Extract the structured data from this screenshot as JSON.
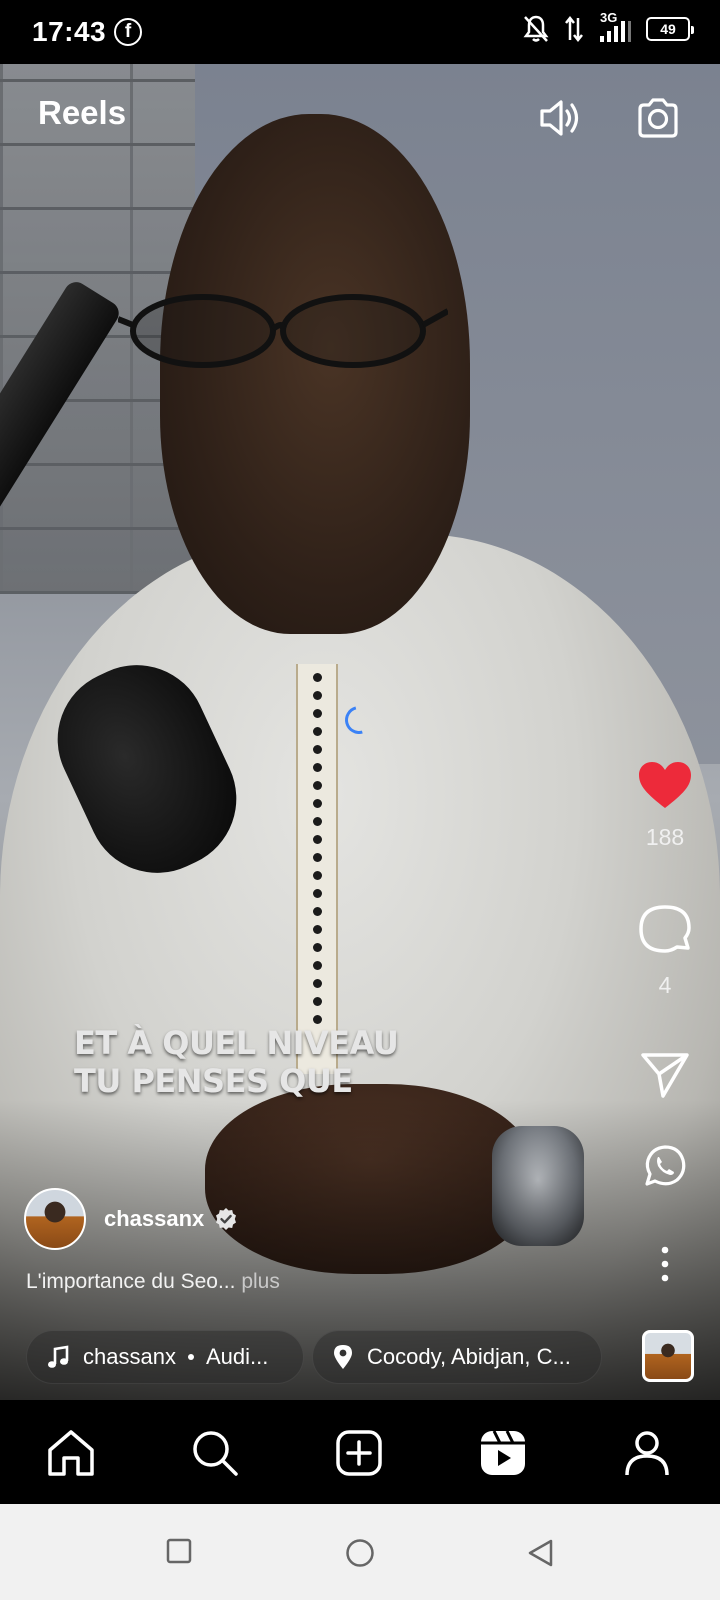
{
  "status_bar": {
    "time": "17:43",
    "network": "3G",
    "battery": "49",
    "icons": [
      "facebook-icon",
      "notifications-off-icon",
      "data-arrows-icon",
      "signal-icon",
      "battery-icon"
    ]
  },
  "header": {
    "title": "Reels",
    "icons": [
      "volume-icon",
      "camera-icon"
    ]
  },
  "video": {
    "caption_lines": [
      "ET À QUEL NIVEAU",
      "TU PENSES QUE"
    ],
    "loading": true
  },
  "actions": {
    "like_count": "188",
    "comment_count": "4",
    "colors": {
      "like": "#ed2a3a"
    },
    "icons": [
      "heart-icon",
      "comment-icon",
      "share-icon",
      "whatsapp-icon",
      "more-icon"
    ]
  },
  "post": {
    "author": "chassanx",
    "verified": true,
    "description": "L'importance du Seo...",
    "more_label": "plus",
    "audio_author": "chassanx",
    "audio_label": "Audi...",
    "location": "Cocody, Abidjan, C..."
  },
  "bottom_nav": [
    "home-icon",
    "search-icon",
    "create-icon",
    "reels-icon",
    "profile-icon"
  ],
  "system_nav": [
    "recents-button",
    "home-button",
    "back-button"
  ]
}
